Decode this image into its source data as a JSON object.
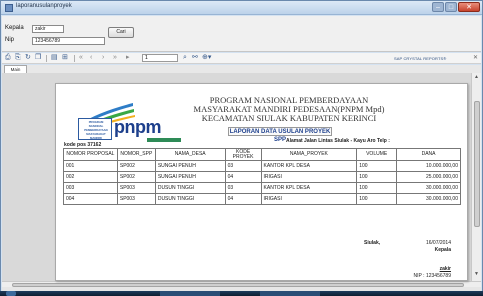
{
  "window": {
    "title": "laporanusulanproyek"
  },
  "form": {
    "kepala_label": "Kepala",
    "kepala_value": "zakir",
    "nip_label": "Nip",
    "nip_value": "123456789",
    "cari_button": "Cari"
  },
  "toolbar": {
    "page_value": "1",
    "brand": "SAP CRYSTAL REPORTS®",
    "close_glyph": "✕"
  },
  "tabs": [
    {
      "label": "Main Report"
    }
  ],
  "report": {
    "program_line1": "PROGRAM NASIONAL PEMBERDAYAAN",
    "program_line2": "MASYARAKAT MANDIRI PEDESAAN(PNPM Mpd)",
    "program_line3": "KECAMATAN SIULAK KABUPATEN KERINCI",
    "report_title": "LAPORAN DATA USULAN PROYEK SPP",
    "logo_text_1": "PROGRAM",
    "logo_text_2": "NASIONAL",
    "logo_text_3": "PEMBERDAYAAN",
    "logo_text_4": "MASYARAKAT",
    "logo_text_5": "MANDIRI",
    "logo_brand": "pnpm",
    "kode_pos": "kode pos 37162",
    "alamat": "Alamat Jalan Lintas Siulak - Kayu Aro Telp :",
    "columns": [
      "NOMOR PROPOSAL",
      "NOMOR_SPP",
      "NAMA_DESA",
      "KODE PROYEK",
      "NAMA_PROYEK",
      "VOLUME",
      "DANA"
    ],
    "rows": [
      [
        "001",
        "SP002",
        "SUNGAI PENUH",
        "03",
        "KANTOR KPL DESA",
        "100",
        "10.000.000,00"
      ],
      [
        "002",
        "SP002",
        "SUNGAI PENUH",
        "04",
        "IRIGASI",
        "100",
        "25.000.000,00"
      ],
      [
        "003",
        "SP003",
        "DUSUN TINGGI",
        "03",
        "KANTOR KPL DESA",
        "100",
        "30.000.000,00"
      ],
      [
        "004",
        "SP003",
        "DUSUN TINGGI",
        "04",
        "IRIGASI",
        "100",
        "30.000.000,00"
      ]
    ],
    "sig_place": "Siulak,",
    "sig_date": "16/07/2014",
    "sig_role": "Kepala",
    "sig_name": "zakir",
    "sig_nip_label": "NIP :",
    "sig_nip_value": "123456789"
  },
  "colors": {
    "accent": "#1d3f8c",
    "green": "#2e8b57"
  }
}
